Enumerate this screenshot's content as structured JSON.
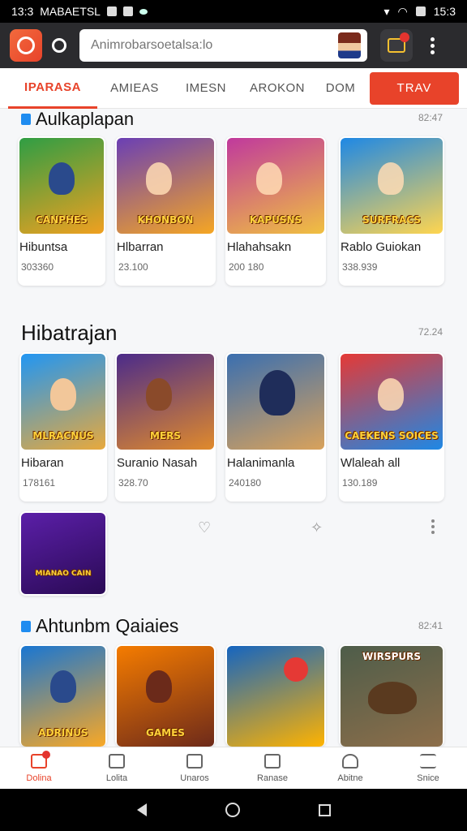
{
  "status_bar": {
    "time": "13:3",
    "carrier": "MABAETSL",
    "clock_right": "15:3"
  },
  "search": {
    "placeholder": "Animrobarsoetalsa:lo"
  },
  "tabs": [
    {
      "label": "IPARASA",
      "active": true
    },
    {
      "label": "AMIEAS",
      "active": false
    },
    {
      "label": "IMESN",
      "active": false
    },
    {
      "label": "AROKON",
      "active": false
    },
    {
      "label": "DOM",
      "active": false
    }
  ],
  "tab_cta": "TRAV",
  "sections": [
    {
      "title": "Aulkaplapan",
      "meta": "82:47",
      "cards": [
        {
          "thumb_title": "CANPHES",
          "name": "Hibuntsa",
          "count": "303360"
        },
        {
          "thumb_title": "KHONBON",
          "name": "Hlbarran",
          "count": "23.100"
        },
        {
          "thumb_title": "KAPUSNS",
          "name": "Hlahahsakn",
          "count": "200 180"
        },
        {
          "thumb_title": "SURFRACS",
          "name": "Rablo Guiokan",
          "count": "338.939"
        }
      ]
    },
    {
      "title": "Hibatrajan",
      "meta": "72.24",
      "cards": [
        {
          "thumb_title": "MLRACNUS",
          "name": "Hibaran",
          "count": "178161"
        },
        {
          "thumb_title": "MERS",
          "name": "Suranio Nasah",
          "count": "328.70"
        },
        {
          "thumb_title": "",
          "name": "Halanimanla",
          "count": "240180"
        },
        {
          "thumb_title": "CAEKENS SOICES",
          "name": "Wlaleah all",
          "count": "130.189"
        },
        {
          "thumb_title": "MIANAO CAIN",
          "name": "",
          "count": ""
        }
      ]
    },
    {
      "title": "Ahtunbm Qaiaies",
      "meta": "82:41",
      "cards": [
        {
          "thumb_title": "ADRINUS",
          "name": "",
          "count": ""
        },
        {
          "thumb_title": "GAMES",
          "name": "",
          "count": ""
        },
        {
          "thumb_title": "",
          "name": "",
          "count": ""
        },
        {
          "thumb_title": "WIRSPURS",
          "name": "",
          "count": ""
        }
      ]
    }
  ],
  "bottom_nav": [
    {
      "label": "Dolina",
      "icon": "home-icon",
      "active": true
    },
    {
      "label": "Lolita",
      "icon": "library-icon",
      "active": false
    },
    {
      "label": "Unaros",
      "icon": "inbox-icon",
      "active": false
    },
    {
      "label": "Ranase",
      "icon": "box-icon",
      "active": false
    },
    {
      "label": "Abitne",
      "icon": "user-icon",
      "active": false
    },
    {
      "label": "Snice",
      "icon": "menu-icon",
      "active": false
    }
  ]
}
